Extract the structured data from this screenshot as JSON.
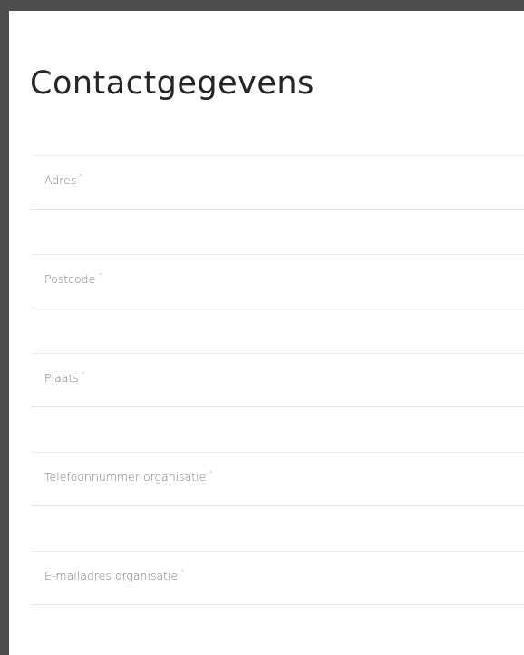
{
  "form": {
    "title": "Contactgegevens",
    "required_marker": "*",
    "fields": [
      {
        "label": "Adres"
      },
      {
        "label": "Postcode"
      },
      {
        "label": "Plaats"
      },
      {
        "label": "Telefoonnummer organisatie"
      },
      {
        "label": "E-mailadres organisatie"
      }
    ]
  },
  "colors": {
    "page_background": "#4d4d4d",
    "panel_background": "#ffffff",
    "title_text": "#262626",
    "label_text": "#7a7a7a",
    "field_border": "#e4e4e4"
  }
}
